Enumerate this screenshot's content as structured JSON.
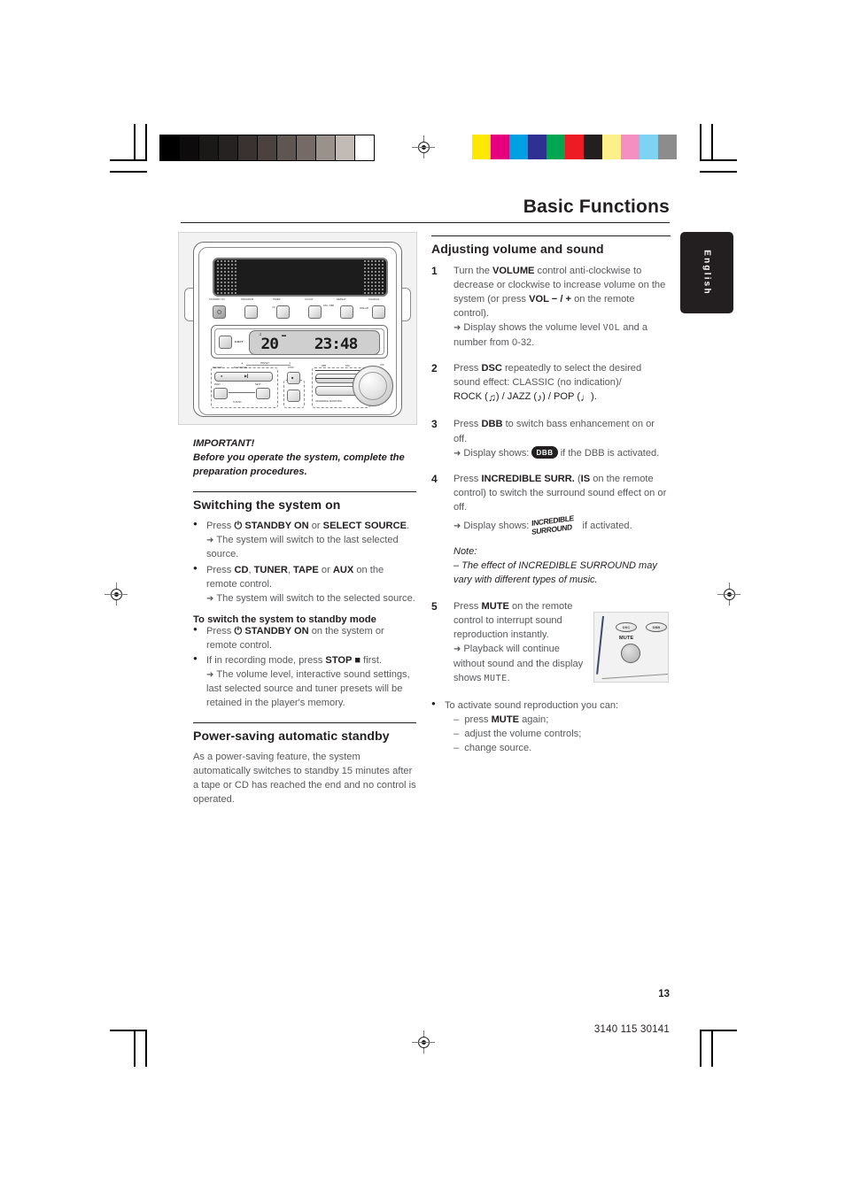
{
  "page": {
    "title": "Basic Functions",
    "language_tab": "English",
    "page_number": "13",
    "document_code": "3140 115 30141"
  },
  "calibration": {
    "gray_scale": [
      "#000000",
      "#0d0b0b",
      "#1b1818",
      "#272222",
      "#393230",
      "#4b423f",
      "#5f5551",
      "#756a66",
      "#9a918d",
      "#c2bab5",
      "#ffffff"
    ],
    "color_swatches": [
      "#ffe800",
      "#e6007e",
      "#00a0e3",
      "#2e3192",
      "#00a650",
      "#ed1c24",
      "#231f20",
      "#fbf08a",
      "#f58fc2",
      "#7ed2f2",
      "#8c8c8c"
    ]
  },
  "device_figure": {
    "caption": "philips-stereo-system-front-panel",
    "top_buttons": [
      {
        "label": "STANDBY ON",
        "type": "standby"
      },
      {
        "label": "PROGRAM",
        "type": "plain"
      },
      {
        "label": "TIMER",
        "type": "plain"
      },
      {
        "label": "CLOCK",
        "type": "plain"
      },
      {
        "label": "REPEAT",
        "type": "plain"
      },
      {
        "label": "SHUFFLE",
        "type": "plain"
      }
    ],
    "side_labels": [
      "CD",
      "DSC / DBB",
      "SIDE A/B"
    ],
    "eject_label": "EJECT",
    "lcd": {
      "left_value": "20",
      "right_value": "23:48"
    },
    "lower_labels": {
      "preset": "PRESET",
      "preset_down": "▲",
      "preset_up": "▼",
      "record": "RECORD",
      "play_pause": "PLAY/PAUSE",
      "stop": "STOP",
      "prev": "PREV",
      "next": "NEXT",
      "tuning": "TUNING",
      "dbb": "DBB",
      "dsc": "DSC",
      "surround": "INCREDIBLE SURROUND",
      "volume": "VOL"
    }
  },
  "remote_figure": {
    "caption": "remote-control-mute-detail",
    "dsc_label": "DSC",
    "dbb_label": "DBB",
    "mute_label": "MUTE"
  },
  "left_column": {
    "important_heading": "IMPORTANT!",
    "important_body": "Before you operate the system, complete the preparation procedures.",
    "section1": {
      "heading": "Switching the system on",
      "items": [
        {
          "parts": [
            {
              "t": "Press ",
              "s": "n"
            },
            {
              "t": "⏻ ",
              "s": "b"
            },
            {
              "t": "STANDBY ON",
              "s": "b"
            },
            {
              "t": " or ",
              "s": "n"
            },
            {
              "t": "SELECT SOURCE",
              "s": "b"
            },
            {
              "t": ".",
              "s": "n"
            }
          ],
          "result": "The system will switch to the last selected source."
        },
        {
          "parts": [
            {
              "t": "Press ",
              "s": "n"
            },
            {
              "t": "CD",
              "s": "b"
            },
            {
              "t": ", ",
              "s": "n"
            },
            {
              "t": "TUNER",
              "s": "b"
            },
            {
              "t": ", ",
              "s": "n"
            },
            {
              "t": "TAPE",
              "s": "b"
            },
            {
              "t": " or ",
              "s": "n"
            },
            {
              "t": "AUX",
              "s": "b"
            },
            {
              "t": " on the remote control.",
              "s": "n"
            }
          ],
          "result": "The system will switch to the selected source."
        }
      ],
      "standby_subhead": "To switch the system to standby mode",
      "standby_items": [
        {
          "parts": [
            {
              "t": "Press ",
              "s": "n"
            },
            {
              "t": "⏻ ",
              "s": "b"
            },
            {
              "t": "STANDBY ON",
              "s": "b"
            },
            {
              "t": " on the system or remote control.",
              "s": "n"
            }
          ]
        },
        {
          "parts": [
            {
              "t": "If in recording mode, press ",
              "s": "n"
            },
            {
              "t": "STOP",
              "s": "b"
            },
            {
              "t": " ■",
              "s": "b"
            },
            {
              "t": "  first.",
              "s": "n"
            }
          ],
          "result": "The volume level, interactive sound settings, last selected source and tuner presets will be retained in the player's memory."
        }
      ]
    },
    "section2": {
      "heading": "Power-saving automatic standby",
      "body": "As a power-saving feature, the system automatically switches to standby 15 minutes after a tape or CD has reached the end and no control is operated."
    }
  },
  "right_column": {
    "heading": "Adjusting volume and sound",
    "steps": [
      {
        "num": "1",
        "parts": [
          {
            "t": "Turn the ",
            "s": "n"
          },
          {
            "t": "VOLUME",
            "s": "b"
          },
          {
            "t": " control anti-clockwise to decrease or clockwise to increase volume on the system (or press ",
            "s": "n"
          },
          {
            "t": "VOL",
            "s": "b"
          },
          {
            "t": "  − / +",
            "s": "b"
          },
          {
            "t": "  on the remote control).",
            "s": "n"
          }
        ],
        "result_pre": "Display shows the volume level ",
        "result_lcd": "VOL",
        "result_post": " and a number from 0-32."
      },
      {
        "num": "2",
        "parts": [
          {
            "t": "Press ",
            "s": "n"
          },
          {
            "t": "DSC",
            "s": "b"
          },
          {
            "t": " repeatedly to select the desired sound effect: ",
            "s": "n"
          },
          {
            "t": "CLASSIC",
            "s": "e"
          },
          {
            "t": " (no indication)/",
            "s": "n"
          }
        ],
        "effects": [
          {
            "name": "ROCK",
            "icon": "guitar-note-icon"
          },
          {
            "name": "JAZZ",
            "icon": "eighth-note-icon"
          },
          {
            "name": "POP",
            "icon": "quarter-note-icon"
          }
        ]
      },
      {
        "num": "3",
        "parts": [
          {
            "t": "Press ",
            "s": "n"
          },
          {
            "t": "DBB",
            "s": "b"
          },
          {
            "t": " to switch bass enhancement on or off.",
            "s": "n"
          }
        ],
        "result_pre": "Display shows: ",
        "result_badge": "DBB",
        "result_post": " if the DBB is activated."
      },
      {
        "num": "4",
        "parts": [
          {
            "t": "Press ",
            "s": "n"
          },
          {
            "t": "INCREDIBLE SURR.",
            "s": "b"
          },
          {
            "t": " (",
            "s": "n"
          },
          {
            "t": "IS",
            "s": "b"
          },
          {
            "t": " on the remote control) to switch the surround sound effect on or off.",
            "s": "n"
          }
        ],
        "result_pre": "Display shows: ",
        "result_logo_line1": "INCREDIBLE",
        "result_logo_line2": "SURROUND",
        "result_post": " if activated."
      },
      {
        "num": "5",
        "parts": [
          {
            "t": "Press ",
            "s": "n"
          },
          {
            "t": "MUTE",
            "s": "b"
          },
          {
            "t": " on the remote control to interrupt sound reproduction instantly.",
            "s": "n"
          }
        ],
        "result_pre": "Playback will continue without sound and the display shows ",
        "result_lcd": "MUTE",
        "result_post": "."
      }
    ],
    "note_label": "Note:",
    "note_text": "–  The effect of INCREDIBLE SURROUND may vary with different types of music.",
    "final_bullet": {
      "lead": "To activate sound reproduction you can:",
      "items": [
        {
          "dash": "–",
          "pre": "press ",
          "bold": "MUTE",
          "post": " again;"
        },
        {
          "dash": "–",
          "pre": "adjust the volume controls;",
          "bold": "",
          "post": ""
        },
        {
          "dash": "–",
          "pre": "change source.",
          "bold": "",
          "post": ""
        }
      ]
    }
  }
}
